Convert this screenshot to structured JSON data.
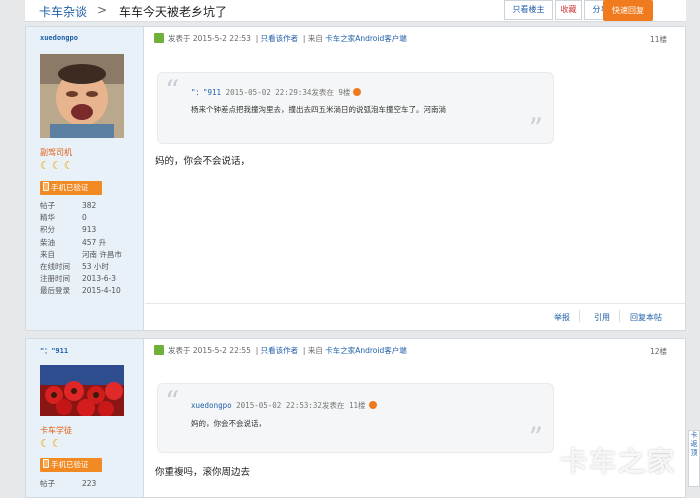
{
  "header": {
    "breadcrumb": "卡车杂谈",
    "breadcrumb_sep": ">",
    "title": "车车今天被老乡坑了",
    "author_only": "只看楼主",
    "favorite": "收藏",
    "share": "分享",
    "quick_reply": "快速回复"
  },
  "posts": [
    {
      "user": {
        "name": "xuedongpo",
        "rank": "副驾司机",
        "moons": "☾☾☾",
        "verified": "手机已验证",
        "stats": [
          {
            "k": "帖子",
            "v": "382"
          },
          {
            "k": "精华",
            "v": "0"
          },
          {
            "k": "积分",
            "v": "913"
          },
          {
            "k": "柴油",
            "v": "457 升"
          },
          {
            "k": "来自",
            "v": "河南 许昌市"
          },
          {
            "k": "在线时间",
            "v": "53 小时"
          },
          {
            "k": "注册时间",
            "v": "2013-6-3"
          },
          {
            "k": "最后登录",
            "v": "2015-4-10"
          }
        ]
      },
      "meta": {
        "posted": "发表于 2015-5-2 22:53",
        "author_only": "只看该作者",
        "from_label": "来自",
        "client": "卡车之家Android客户端",
        "floor": "11楼"
      },
      "quote": {
        "who": "\"：\"911",
        "when": "2015-05-02 22:29:34发表在 9楼",
        "text": "杨来个钟差点把我撞沟里去，撞出去四五米淌日的说弧泡车撞空车了。河南淌"
      },
      "body": "妈的，你会不会说话，",
      "footer": {
        "report": "举报",
        "quote": "引用",
        "reply": "回复本帖"
      }
    },
    {
      "user": {
        "name": "\"：\"911",
        "rank": "卡车学徒",
        "moons": "☾☾",
        "verified": "手机已验证",
        "stats": [
          {
            "k": "帖子",
            "v": "223"
          }
        ]
      },
      "meta": {
        "posted": "发表于 2015-5-2 22:55",
        "author_only": "只看该作者",
        "from_label": "来自",
        "client": "卡车之家Android客户端",
        "floor": "12楼"
      },
      "quote": {
        "who": "xuedongpo",
        "when": "2015-05-02 22:53:32发表在 11楼",
        "text": "妈的，你会不会说话，"
      },
      "body": "你重複吗，滚你周边去"
    }
  ],
  "watermark": "卡车之家",
  "edge": {
    "line1": "卡",
    "line2": "返",
    "line3": "顶"
  }
}
